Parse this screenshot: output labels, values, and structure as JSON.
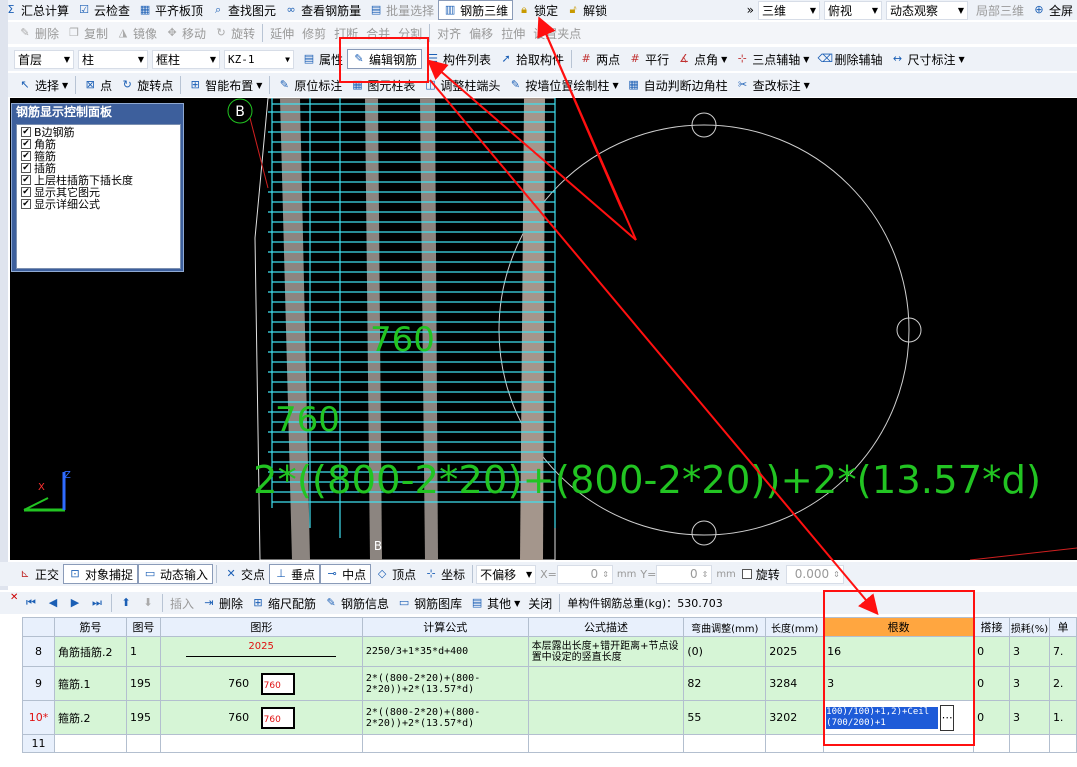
{
  "toolbar1": {
    "items": [
      "汇总计算",
      "云检查",
      "平齐板顶",
      "查找图元",
      "查看钢筋量",
      "批量选择",
      "钢筋三维",
      "锁定",
      "解锁"
    ],
    "view_mode": "三维",
    "view_dir": "俯视",
    "dynamic": "动态观察",
    "local3d": "局部三维",
    "fullscreen": "全屏",
    "more": "»"
  },
  "toolbar2": {
    "items": [
      "删除",
      "复制",
      "镜像",
      "移动",
      "旋转",
      "延伸",
      "修剪",
      "打断",
      "合并",
      "分割",
      "对齐",
      "偏移",
      "拉伸",
      "设置夹点"
    ]
  },
  "toolbar3": {
    "floor": "首层",
    "category": "柱",
    "type": "框柱",
    "member": "KZ-1",
    "items": [
      "属性",
      "编辑钢筋",
      "构件列表",
      "拾取构件",
      "两点",
      "平行",
      "点角",
      "三点辅轴",
      "删除辅轴",
      "尺寸标注"
    ]
  },
  "toolbar4": {
    "items": [
      "选择",
      "点",
      "旋转点",
      "智能布置",
      "原位标注",
      "图元柱表",
      "调整柱端头",
      "按墙位置绘制柱",
      "自动判断边角柱",
      "查改标注"
    ]
  },
  "panel": {
    "title": "钢筋显示控制面板",
    "options": [
      "B边钢筋",
      "角筋",
      "箍筋",
      "插筋",
      "上层柱插筋下插长度",
      "显示其它图元",
      "显示详细公式"
    ]
  },
  "viewport": {
    "label_1": "760",
    "label_2": "760",
    "formula": "2*((800-2*20)+(800-2*20))+2*(13.57*d)",
    "axis_b": "B",
    "axis_b2": "B"
  },
  "snap_bar": {
    "items": [
      "正交",
      "对象捕捉",
      "动态输入",
      "交点",
      "垂点",
      "中点",
      "顶点",
      "坐标"
    ],
    "offset": "不偏移",
    "x_label": "X=",
    "x_value": "0",
    "y_label": "Y=",
    "y_value": "0",
    "unit": "mm",
    "rotate": "旋转",
    "rotate_value": "0.000"
  },
  "grid_toolbar": {
    "items": [
      "插入",
      "删除",
      "缩尺配筋",
      "钢筋信息",
      "钢筋图库",
      "其他",
      "关闭"
    ],
    "total": "单构件钢筋总重(kg)：530.703"
  },
  "table": {
    "headers": [
      "筋号",
      "图号",
      "图形",
      "计算公式",
      "公式描述",
      "弯曲调整(mm)",
      "长度(mm)",
      "根数",
      "搭接",
      "损耗(%)",
      "单"
    ],
    "rows": [
      {
        "no": "8",
        "name": "角筋插筋.2",
        "fig": "1",
        "shape_text": "2025",
        "formula": "2250/3+1*35*d+400",
        "desc": "本层露出长度+错开距离+节点设置中设定的竖直长度",
        "bend": "(0)",
        "length": "2025",
        "count": "16",
        "lap": "0",
        "loss": "3",
        "unit": "7."
      },
      {
        "no": "9",
        "name": "箍筋.1",
        "fig": "195",
        "shape_left": "760",
        "shape_in": "760",
        "formula": "2*((800-2*20)+(800-2*20))+2*(13.57*d)",
        "desc": "",
        "bend": "82",
        "length": "3284",
        "count": "3",
        "lap": "0",
        "loss": "3",
        "unit": "2."
      },
      {
        "no": "10*",
        "name": "箍筋.2",
        "fig": "195",
        "shape_left": "760",
        "shape_in": "760",
        "formula": "2*((800-2*20)+(800-2*20))+2*(13.57*d)",
        "desc": "",
        "bend": "55",
        "length": "3202",
        "count": "100)/100)+1,2)+Ceil(700/200)+1",
        "lap": "0",
        "loss": "3",
        "unit": "1."
      },
      {
        "no": "11"
      }
    ]
  },
  "colors": {
    "annotation_red": "#ff1010",
    "rebar_cyan": "#3fe0f0",
    "text_green": "#22c422",
    "highlight": "#ffa640"
  }
}
